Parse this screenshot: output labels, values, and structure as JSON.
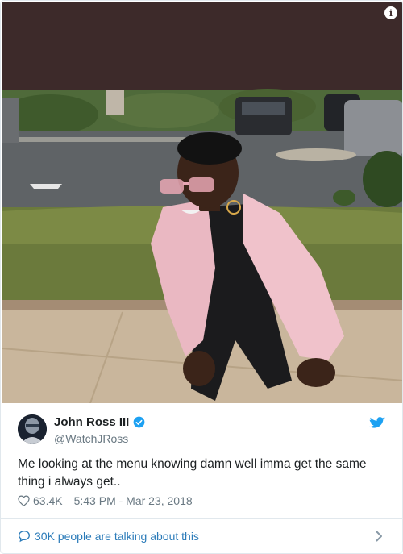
{
  "tweet": {
    "display_name": "John Ross III",
    "handle": "@WatchJRoss",
    "text": "Me looking at the menu knowing damn well imma get the same thing i always get..",
    "likes": "63.4K",
    "timestamp": "5:43 PM - Mar 23, 2018"
  },
  "footer": {
    "talking_label": "30K people are talking about this"
  },
  "icons": {
    "info": "info-icon",
    "verified": "verified-badge-icon",
    "twitter": "twitter-bird-icon",
    "heart": "heart-icon",
    "bubble": "speech-bubble-icon",
    "chevron": "chevron-right-icon"
  },
  "colors": {
    "link": "#2b7bb9",
    "muted_text": "#697882",
    "border": "#e1e8ed",
    "photo_top": "#3d2a2a"
  }
}
